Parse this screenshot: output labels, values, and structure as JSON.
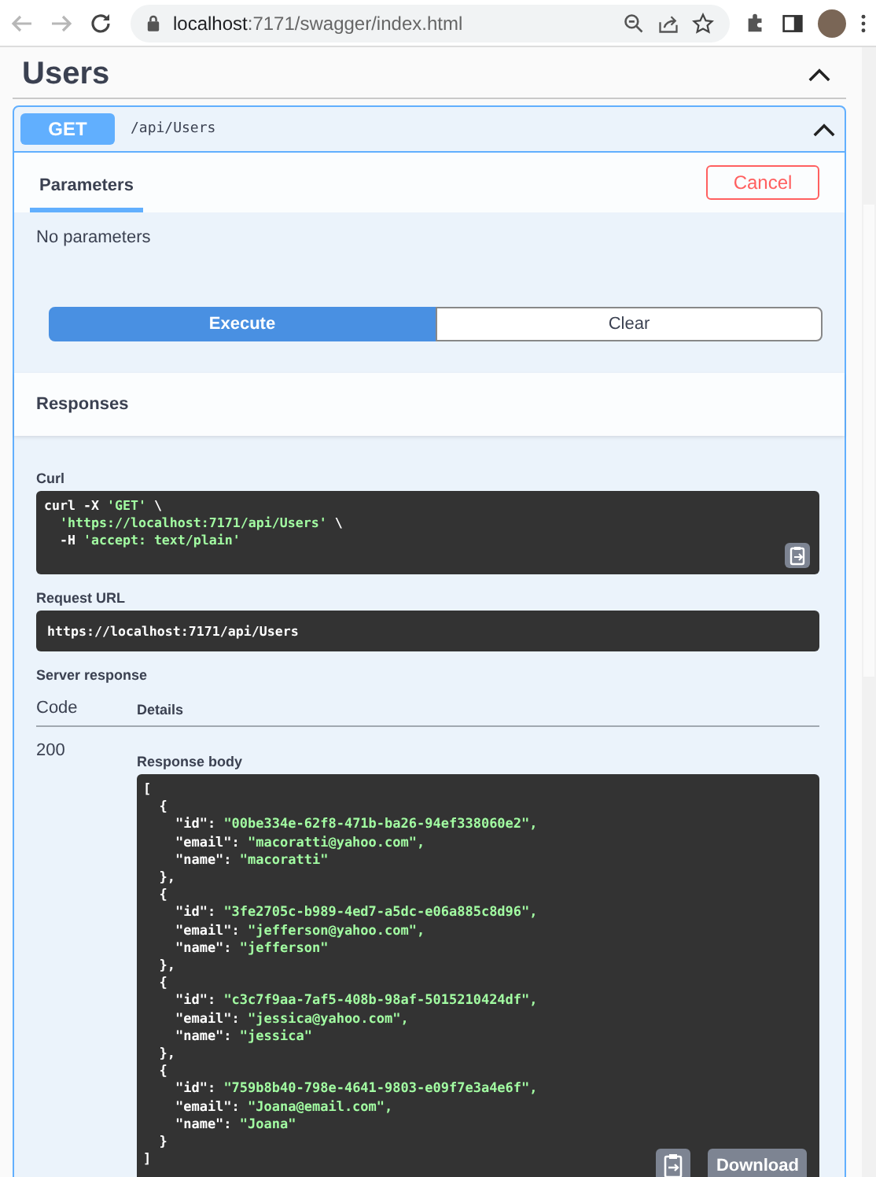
{
  "browser": {
    "host": "localhost",
    "path": ":7171/swagger/index.html"
  },
  "section": {
    "title": "Users",
    "expanded": true
  },
  "operation": {
    "method": "GET",
    "path": "/api/Users",
    "expanded": true,
    "tabs": [
      {
        "label": "Parameters",
        "selected": true
      }
    ],
    "cancel_button": "Cancel",
    "parameters_message": "No parameters",
    "buttons": [
      {
        "label": "Execute",
        "kind": "primary"
      },
      {
        "label": "Clear",
        "kind": "secondary"
      }
    ],
    "responses_title": "Responses",
    "curl": {
      "label": "Curl",
      "lines": [
        "curl -X 'GET' \\",
        "  'https://localhost:7171/api/Users' \\",
        "  -H 'accept: text/plain'"
      ]
    },
    "request_url": {
      "label": "Request URL",
      "value": "https://localhost:7171/api/Users"
    },
    "server_response": {
      "title": "Server response",
      "columns": [
        "Code",
        "Details"
      ],
      "code": "200",
      "body_label": "Response body",
      "body_lines": [
        "[",
        "  {",
        "    \"id\": \"00be334e-62f8-471b-ba26-94ef338060e2\",",
        "    \"email\": \"macoratti@yahoo.com\",",
        "    \"name\": \"macoratti\"",
        "  },",
        "  {",
        "    \"id\": \"3fe2705c-b989-4ed7-a5dc-e06a885c8d96\",",
        "    \"email\": \"jefferson@yahoo.com\",",
        "    \"name\": \"jefferson\"",
        "  },",
        "  {",
        "    \"id\": \"c3c7f9aa-7af5-408b-98af-5015210424df\",",
        "    \"email\": \"jessica@yahoo.com\",",
        "    \"name\": \"jessica\"",
        "  },",
        "  {",
        "    \"id\": \"759b8b40-798e-4641-9803-e09f7e3a4e6f\",",
        "    \"email\": \"Joana@email.com\",",
        "    \"name\": \"Joana\"",
        "  }",
        "]"
      ],
      "download_button": "Download"
    }
  }
}
